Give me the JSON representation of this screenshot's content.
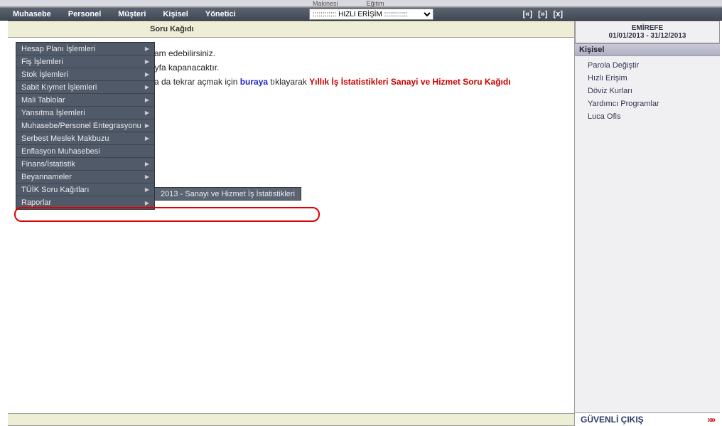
{
  "top_fragments": [
    "Makinesi",
    "Eğitim"
  ],
  "menubar": {
    "items": [
      "Muhasebe",
      "Personel",
      "Müşteri",
      "Kişisel",
      "Yönetici"
    ],
    "quick_access_label": ":::::::::::: HIZLI ERİŞİM ::::::::::::",
    "nav": {
      "back": "[«]",
      "fwd": "[»]",
      "close": "[x]"
    }
  },
  "page_title": "Soru Kağıdı",
  "body": {
    "line1": "vam edebilirsiniz.",
    "line2": "ayfa kapanacaktır.",
    "line3_pre": "ya da tekrar açmak için ",
    "line3_link": "buraya",
    "line3_mid": " tıklayarak ",
    "line3_red": "Yıllık İş İstatistikleri Sanayi ve Hizmet Soru Kağıdı"
  },
  "dropdown": {
    "items": [
      {
        "label": "Hesap Planı İşlemleri",
        "arrow": true
      },
      {
        "label": "Fiş İşlemleri",
        "arrow": true
      },
      {
        "label": "Stok İşlemleri",
        "arrow": true
      },
      {
        "label": "Sabit Kıymet İşlemleri",
        "arrow": true
      },
      {
        "label": "Mali Tablolar",
        "arrow": true
      },
      {
        "label": "Yansıtma İşlemleri",
        "arrow": true
      },
      {
        "label": "Muhasebe/Personel Entegrasyonu",
        "arrow": true
      },
      {
        "label": "Serbest Meslek Makbuzu",
        "arrow": true
      },
      {
        "label": "Enflasyon Muhasebesi",
        "arrow": false
      },
      {
        "label": "Finans/İstatistik",
        "arrow": true
      },
      {
        "label": "Beyannameler",
        "arrow": true
      },
      {
        "label": "TÜİK Soru Kağıtları",
        "arrow": true,
        "active": true
      },
      {
        "label": "Raporlar",
        "arrow": true
      }
    ]
  },
  "submenu": {
    "item": "2013 - Sanayi ve Hizmet İş İstatistikleri"
  },
  "right": {
    "company": "EMİREFE",
    "date_range": "01/01/2013 - 31/12/2013",
    "section_title": "Kişisel",
    "items": [
      "Parola Değiştir",
      "Hızlı Erişim",
      "Döviz Kurları",
      "Yardımcı Programlar",
      "Luca Ofis"
    ],
    "logout": "GÜVENLİ ÇIKIŞ",
    "logout_chev": "»»"
  }
}
